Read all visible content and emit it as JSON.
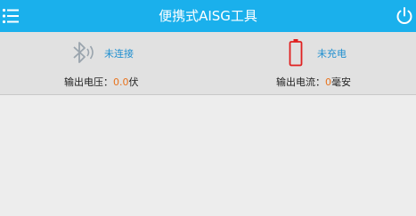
{
  "app": {
    "title": "便携式AISG工具"
  },
  "status": {
    "connection_text": "未连接",
    "charge_text": "未充电",
    "voltage": {
      "label": "输出电压：",
      "value": "0.0",
      "unit": "伏"
    },
    "current": {
      "label": "输出电流：",
      "value": "0",
      "unit": "毫安"
    }
  },
  "colors": {
    "topbar": "#1ab0ec",
    "status_text": "#1f8fd0",
    "value_accent": "#e8721c",
    "battery_empty": "#e02020",
    "bluetooth_icon": "#9aa4ad"
  },
  "icons": {
    "menu": "menu-icon",
    "power": "power-icon",
    "bluetooth": "bluetooth-icon",
    "battery": "battery-icon"
  }
}
